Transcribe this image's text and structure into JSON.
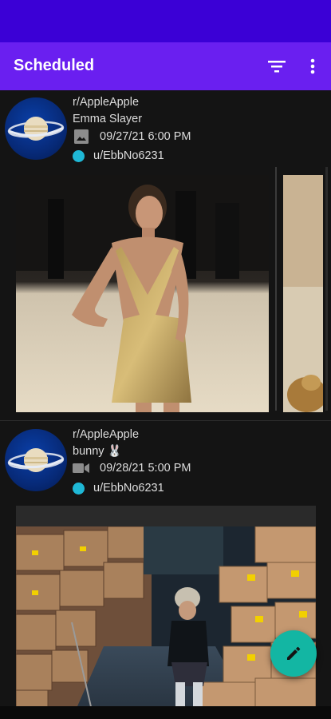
{
  "app": {
    "title": "Scheduled",
    "colors": {
      "status_bar": "#3b00d6",
      "app_bar": "#6a1ff0",
      "fab": "#13b6a3",
      "user_dot": "#1fb8d6"
    },
    "actions": {
      "filter_icon": "filter-icon",
      "more_icon": "more-vertical-icon",
      "fab_icon": "pencil-icon"
    }
  },
  "posts": [
    {
      "subreddit": "r/AppleApple",
      "title": "Emma Slayer",
      "post_type_icon": "image-icon",
      "scheduled_time": "09/27/21 6:00 PM",
      "user": "u/EbbNo6231",
      "avatar_icon": "saturn-icon"
    },
    {
      "subreddit": "r/AppleApple",
      "title": "bunny 🐰",
      "post_type_icon": "video-icon",
      "scheduled_time": "09/28/21 5:00 PM",
      "user": "u/EbbNo6231",
      "avatar_icon": "saturn-icon"
    }
  ]
}
